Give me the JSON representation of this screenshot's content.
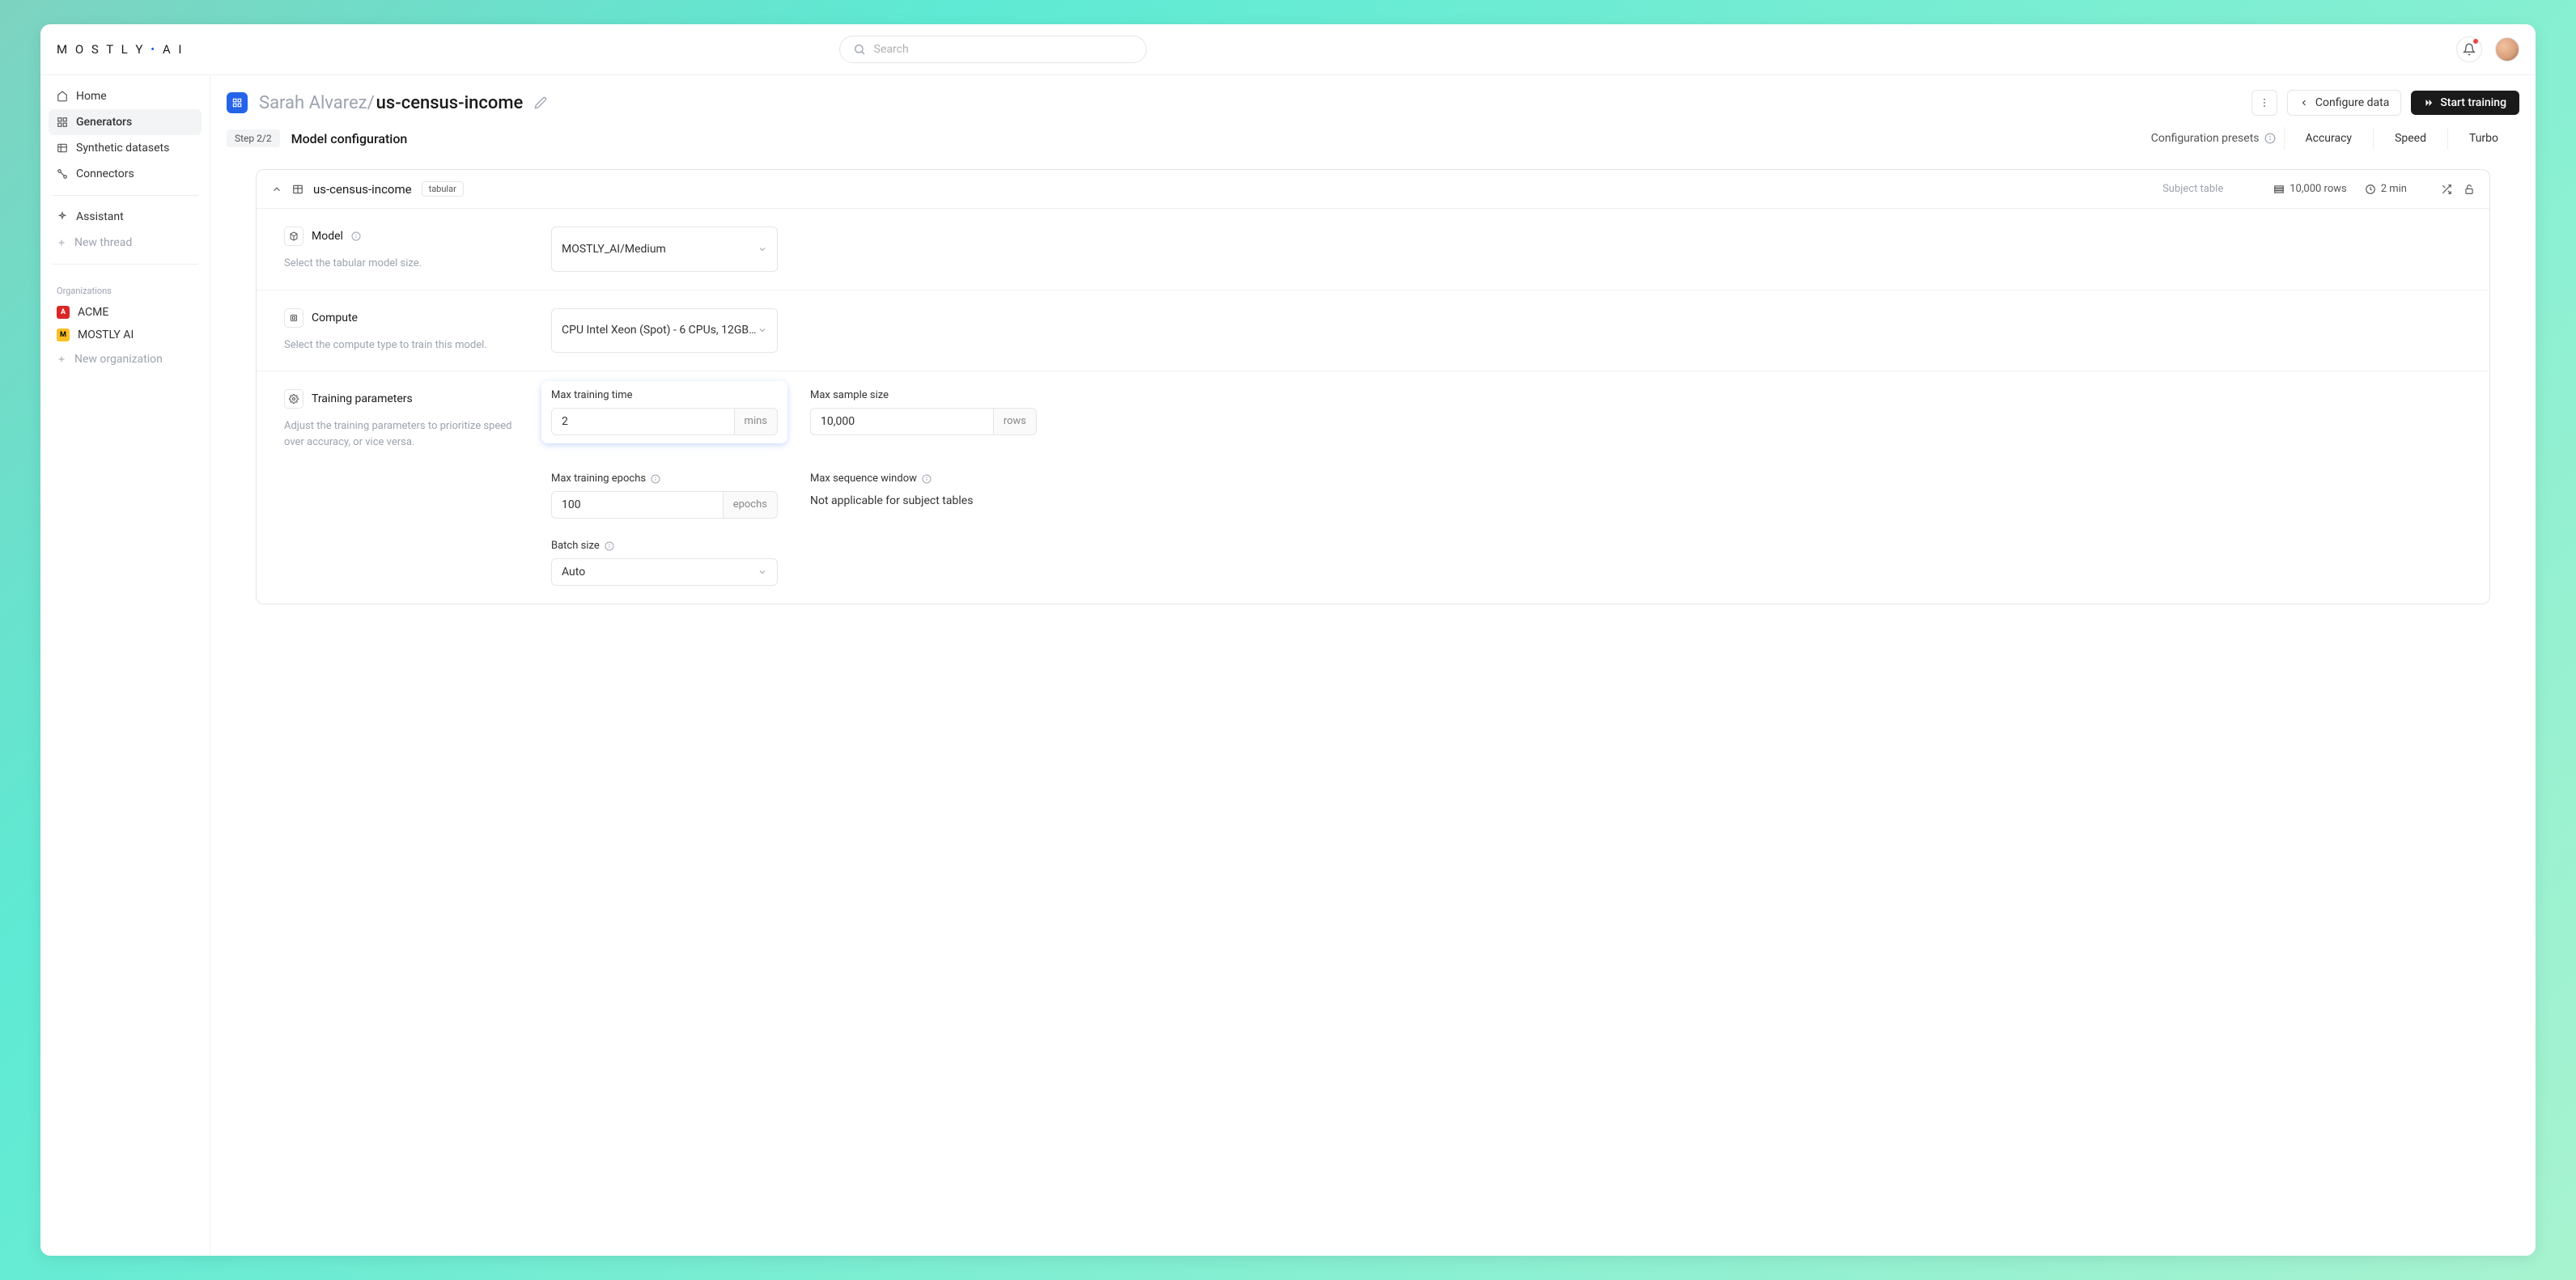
{
  "logo_text": "MOSTLY·AI",
  "search": {
    "placeholder": "Search"
  },
  "sidebar": {
    "nav": [
      {
        "label": "Home"
      },
      {
        "label": "Generators"
      },
      {
        "label": "Synthetic datasets"
      },
      {
        "label": "Connectors"
      }
    ],
    "assistant_label": "Assistant",
    "new_thread_label": "New thread",
    "org_header": "Organizations",
    "orgs": [
      {
        "label": "ACME",
        "badge": "A"
      },
      {
        "label": "MOSTLY AI",
        "badge": "M"
      }
    ],
    "new_org_label": "New organization"
  },
  "header": {
    "owner": "Sarah Alvarez",
    "slash": "/",
    "name": "us-census-income",
    "configure_data_label": "Configure data",
    "start_training_label": "Start training"
  },
  "subhead": {
    "step": "Step 2/2",
    "title": "Model configuration",
    "presets_label": "Configuration presets",
    "presets": [
      "Accuracy",
      "Speed",
      "Turbo"
    ]
  },
  "table_card": {
    "name": "us-census-income",
    "tag": "tabular",
    "subject_label": "Subject table",
    "rows_stat": "10,000 rows",
    "time_stat": "2 min"
  },
  "model_section": {
    "title": "Model",
    "desc": "Select the tabular model size.",
    "select_value": "MOSTLY_AI/Medium"
  },
  "compute_section": {
    "title": "Compute",
    "desc": "Select the compute type to train this model.",
    "select_value": "CPU Intel Xeon (Spot) - 6 CPUs, 12GB…"
  },
  "training_section": {
    "title": "Training parameters",
    "desc": "Adjust the training parameters to prioritize speed over accuracy, or vice versa.",
    "max_training_time": {
      "label": "Max training time",
      "value": "2",
      "unit": "mins"
    },
    "max_sample_size": {
      "label": "Max sample size",
      "value": "10,000",
      "unit": "rows"
    },
    "max_training_epochs": {
      "label": "Max training epochs",
      "value": "100",
      "unit": "epochs"
    },
    "max_seq_window": {
      "label": "Max sequence window",
      "na": "Not applicable for subject tables"
    },
    "batch_size": {
      "label": "Batch size",
      "value": "Auto"
    }
  }
}
